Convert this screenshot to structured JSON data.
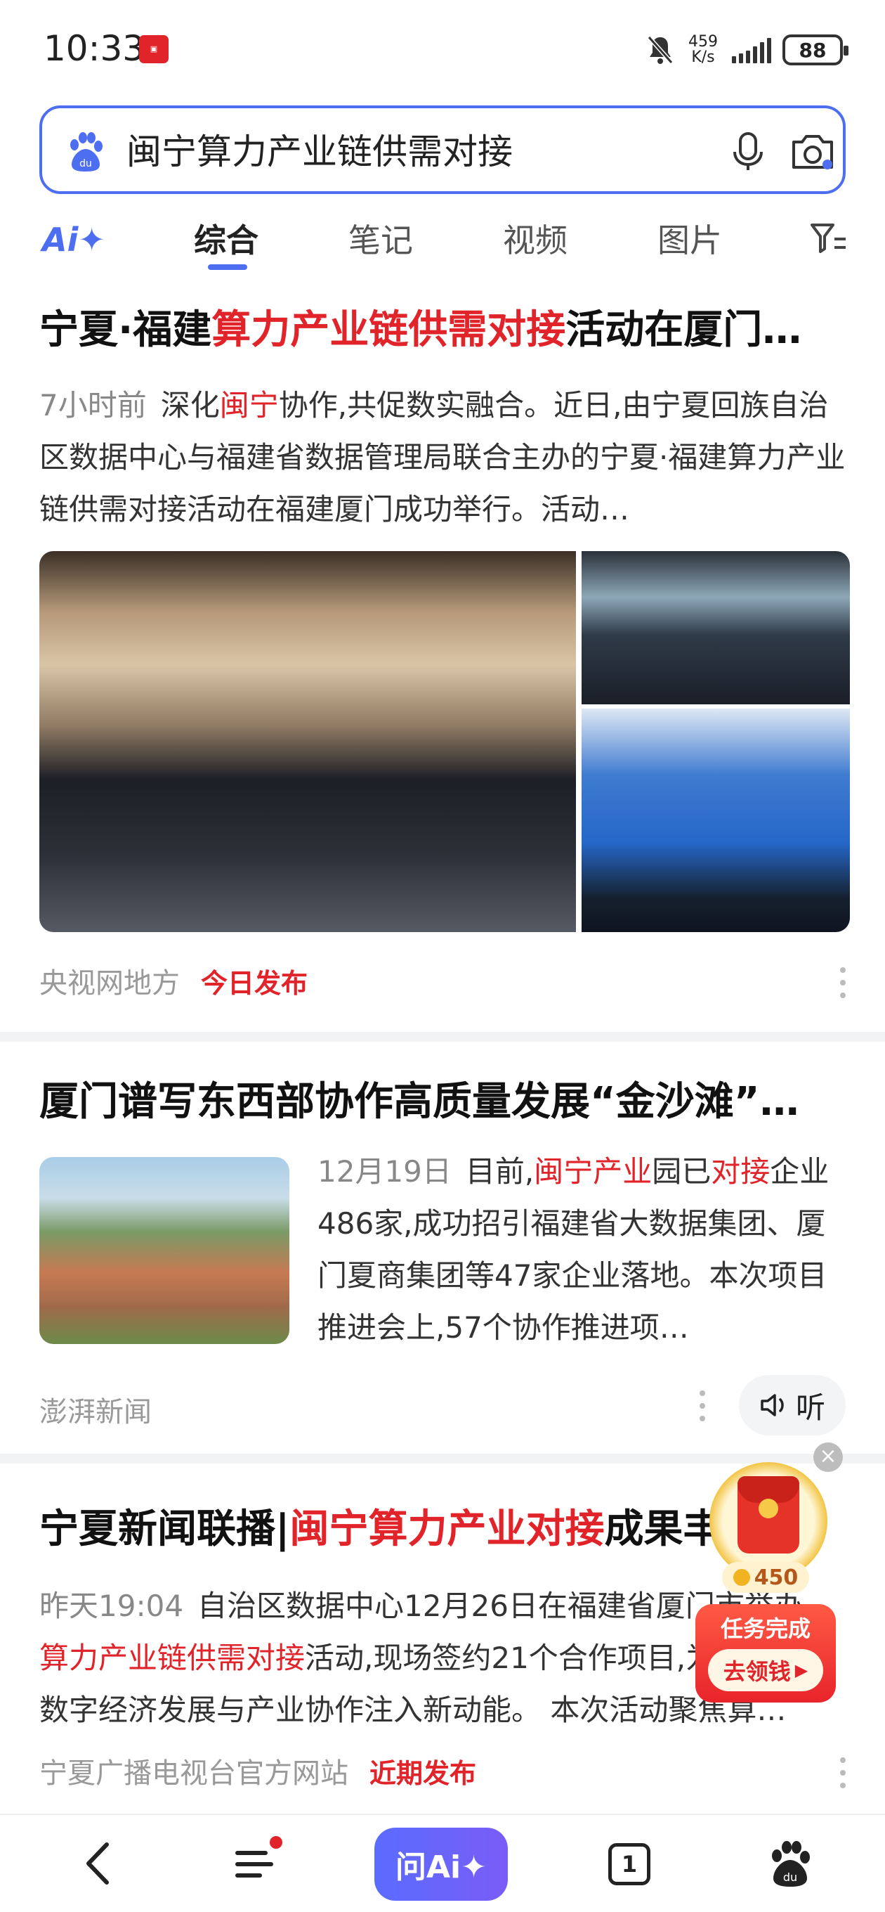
{
  "status_bar": {
    "time": "10:33",
    "speed_value": "459",
    "speed_unit": "K/s",
    "battery": "88"
  },
  "search": {
    "query": "闽宁算力产业链供需对接"
  },
  "tabs": {
    "ai": "Ai✦",
    "items": [
      "综合",
      "笔记",
      "视频",
      "图片"
    ],
    "active": "综合"
  },
  "results": [
    {
      "title_parts": [
        "宁夏·福建",
        "算力产业链供需对接",
        "活动在厦门…"
      ],
      "time": "7小时前",
      "snippet_parts": [
        "深化",
        "闽宁",
        "协作,共促数实融合。近日,由宁夏回族自治区数据中心与福建省数据管理局联合主办的宁夏·福建算力产业链供需对接活动在福建厦门成功举行。活动…"
      ],
      "source": "央视网地方",
      "tag": "今日发布"
    },
    {
      "title": "厦门谱写东西部协作高质量发展“金沙滩”…",
      "time": "12月19日",
      "snippet_parts": [
        "目前,",
        "闽宁产业",
        "园已",
        "对接",
        "企业486家,成功招引福建省大数据集团、厦门夏商集团等47家企业落地。本次项目推进会上,57个协作推进项…"
      ],
      "source": "澎湃新闻",
      "listen": "听"
    },
    {
      "title_parts": [
        "宁夏新闻联播|",
        "闽宁算力产业对接",
        "成果丰…"
      ],
      "time": "昨天19:04",
      "snippet_parts": [
        "自治区数据中心12月26日在福建省厦门市举办",
        "算力产业链供需对接",
        "活动,现场签约21个合作项目,为",
        "数字经济发展与产业协作注入新动能。 本次活动聚焦算…"
      ],
      "source": "宁夏广播电视台官方网站",
      "tag": "近期发布"
    }
  ],
  "float_reward": {
    "coins": "450",
    "title": "任务完成",
    "button": "去领钱"
  },
  "bottom_nav": {
    "ask_label": "问Ai✦",
    "tab_count": "1"
  },
  "colors": {
    "brand_blue": "#4e6ef2",
    "highlight_red": "#e1232a"
  }
}
